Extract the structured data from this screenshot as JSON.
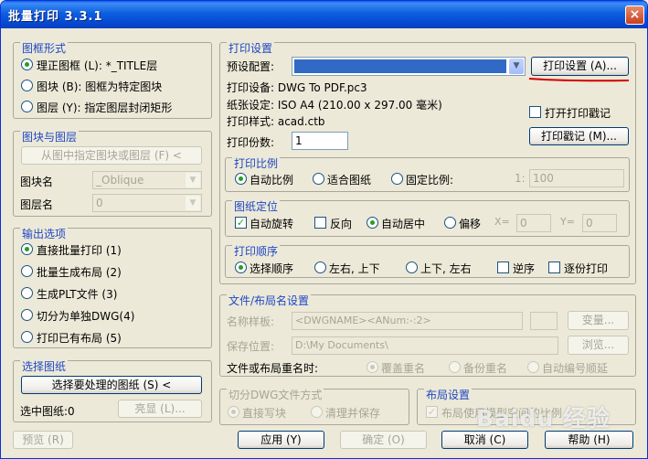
{
  "window": {
    "title": "批量打印 3.3.1",
    "close": "×"
  },
  "frame_type": {
    "title": "图框形式",
    "opt1": "理正图框 (L): *_TITLE层",
    "opt2": "图块 (B): 图框为特定图块",
    "opt3": "图层 (Y): 指定图层封闭矩形"
  },
  "block_layer": {
    "title": "图块与图层",
    "pick_button": "从图中指定图块或图层 (F) <",
    "block_label": "图块名",
    "block_value": "_Oblique",
    "layer_label": "图层名",
    "layer_value": "0"
  },
  "output": {
    "title": "输出选项",
    "opt1": "直接批量打印 (1)",
    "opt2": "批量生成布局 (2)",
    "opt3": "生成PLT文件 (3)",
    "opt4": "切分为单独DWG(4)",
    "opt5": "打印已有布局 (5)"
  },
  "select_drawing": {
    "title": "选择图纸",
    "select_button": "选择要处理的图纸 (S) <",
    "selected_label": "选中图纸:0",
    "highlight_button": "亮显 (L)..."
  },
  "print_settings": {
    "title": "打印设置",
    "preset_label": "预设配置:",
    "setup_button": "打印设置 (A)...",
    "device_line": "打印设备: DWG To PDF.pc3",
    "paper_line": "纸张设定: ISO A4 (210.00 x 297.00 毫米)",
    "style_line": "打印样式: acad.ctb",
    "stamp_check": "打开打印戳记",
    "stamp_button": "打印戳记 (M)...",
    "copies_label": "打印份数:",
    "copies_value": "1"
  },
  "scale": {
    "title": "打印比例",
    "auto": "自动比例",
    "fit": "适合图纸",
    "fixed": "固定比例:",
    "ratio_label": "1:",
    "ratio_value": "100"
  },
  "position": {
    "title": "图纸定位",
    "auto_rotate": "自动旋转",
    "reverse": "反向",
    "auto_center": "自动居中",
    "offset": "偏移",
    "x_label": "X=",
    "x_value": "0",
    "y_label": "Y=",
    "y_value": "0"
  },
  "order": {
    "title": "打印顺序",
    "select_order": "选择顺序",
    "left_right_top_bottom": "左右, 上下",
    "top_bottom_left_right": "上下, 左右",
    "reverse": "逆序",
    "one_by_one": "逐份打印"
  },
  "file_naming": {
    "title": "文件/布局名设置",
    "template_label": "名称样板:",
    "template_value": "<DWGNAME><ANum:-:2>",
    "variable_button": "变量...",
    "save_label": "保存位置:",
    "save_value": "D:\\My Documents\\",
    "browse_button": "浏览...",
    "duplicate_label": "文件或布局重名时:",
    "overwrite": "覆盖重名",
    "backup": "备份重名",
    "auto_number": "自动编号顺延"
  },
  "split_dwg": {
    "title": "切分DWG文件方式",
    "write_block": "直接写块",
    "purge_save": "清理并保存"
  },
  "layout": {
    "title": "布局设置",
    "use_model": "布局使用模型空间的比例"
  },
  "footer": {
    "preview": "预览 (R)",
    "apply": "应用 (Y)",
    "ok": "确定 (O)",
    "cancel": "取消 (C)",
    "help": "帮助 (H)"
  },
  "watermark": "Baidu 经验",
  "colors": {
    "titlebar": "#0a5fe8",
    "group_title": "#1f47c4",
    "combo_selected": "#316ac5",
    "red_mark": "#d40000"
  }
}
